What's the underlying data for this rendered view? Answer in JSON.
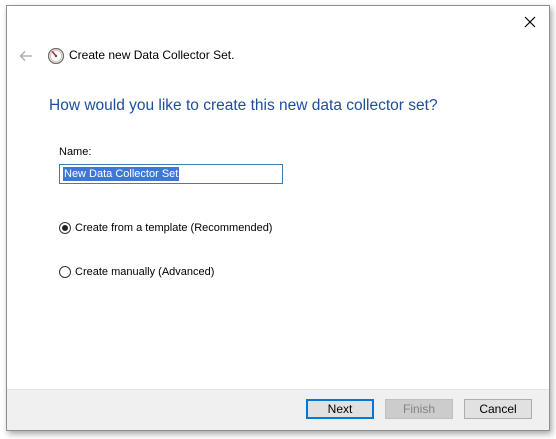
{
  "window": {
    "title": "Create new Data Collector Set."
  },
  "heading": "How would you like to create this new data collector set?",
  "name_field": {
    "label": "Name:",
    "value": "New Data Collector Set"
  },
  "options": [
    {
      "label": "Create from a template (Recommended)",
      "selected": true
    },
    {
      "label": "Create manually (Advanced)",
      "selected": false
    }
  ],
  "buttons": {
    "next": "Next",
    "finish": "Finish",
    "cancel": "Cancel"
  },
  "colors": {
    "heading": "#1c4e9b",
    "selection": "#3b78d8",
    "focus_border": "#0078d7"
  },
  "icons": {
    "close": "close-icon",
    "back": "back-arrow-icon",
    "app": "performance-monitor-icon"
  }
}
